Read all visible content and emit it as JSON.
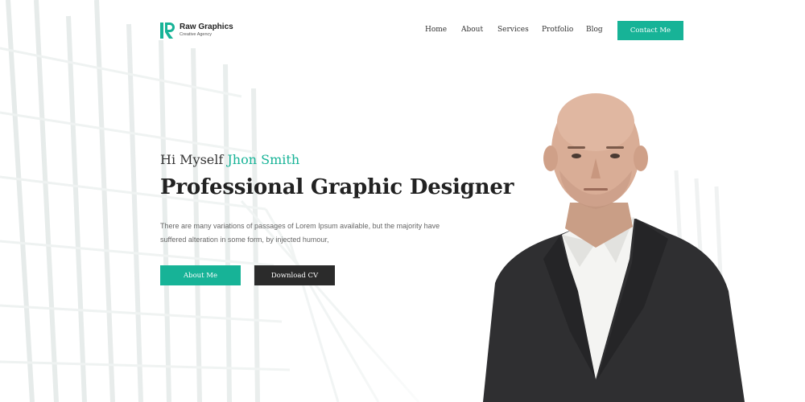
{
  "brand": {
    "title": "Raw Graphics",
    "subtitle": "Creative Agency",
    "accent_color": "#17b397",
    "dark_color": "#2b2b2b"
  },
  "nav": {
    "items": [
      "Home",
      "About",
      "Services",
      "Protfolio",
      "Blog"
    ],
    "contact_label": "Contact Me"
  },
  "hero": {
    "greeting_prefix": "Hi Myself",
    "greeting_name": "Jhon Smith",
    "headline": "Professional Graphic Designer",
    "description": "There are many variations of passages of Lorem Ipsum available, but the majority have suffered alteration in some form, by injected humour,",
    "about_button": "About Me",
    "cv_button": "Download CV"
  }
}
